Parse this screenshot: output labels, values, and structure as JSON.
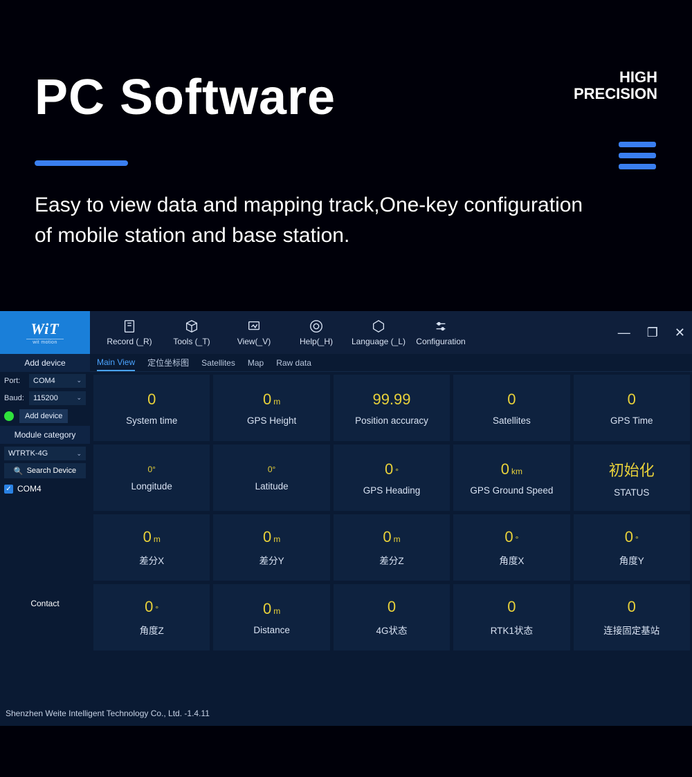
{
  "promo": {
    "title": "PC Software",
    "tag1": "HIGH",
    "tag2": "PRECISION",
    "desc": "Easy to view data and mapping track,One-key configuration of mobile station and base station."
  },
  "sidebar": {
    "logo_main": "WiT",
    "logo_sub": "wit motion",
    "add_device_head": "Add device",
    "port_label": "Port:",
    "port_value": "COM4",
    "baud_label": "Baud:",
    "baud_value": "115200",
    "add_btn": "Add device",
    "module_cat": "Module category",
    "module_value": "WTRTK-4G",
    "search_device": "Search Device",
    "device_item": "COM4",
    "contact": "Contact"
  },
  "toolbar": {
    "items": [
      {
        "label": "Record (_R)"
      },
      {
        "label": "Tools (_T)"
      },
      {
        "label": "View(_V)"
      },
      {
        "label": "Help(_H)"
      },
      {
        "label": "Language (_L)"
      },
      {
        "label": "Configuration"
      }
    ]
  },
  "tabs": [
    "Main View",
    "定位坐标图",
    "Satellites",
    "Map",
    "Raw data"
  ],
  "tiles": [
    {
      "value": "0",
      "unit": "",
      "label": "System time"
    },
    {
      "value": "0",
      "unit": "m",
      "label": "GPS Height"
    },
    {
      "value": "99.99",
      "unit": "",
      "label": "Position accuracy"
    },
    {
      "value": "0",
      "unit": "",
      "label": "Satellites"
    },
    {
      "value": "0",
      "unit": "",
      "label": "GPS Time"
    },
    {
      "value": "0°",
      "unit": "",
      "label": "Longitude",
      "small": true
    },
    {
      "value": "0°",
      "unit": "",
      "label": "Latitude",
      "small": true
    },
    {
      "value": "0",
      "unit": "°",
      "label": "GPS Heading"
    },
    {
      "value": "0",
      "unit": "km",
      "label": "GPS Ground Speed"
    },
    {
      "value": "初始化",
      "unit": "",
      "label": "STATUS"
    },
    {
      "value": "0",
      "unit": "m",
      "label": "差分X"
    },
    {
      "value": "0",
      "unit": "m",
      "label": "差分Y"
    },
    {
      "value": "0",
      "unit": "m",
      "label": "差分Z"
    },
    {
      "value": "0",
      "unit": "°",
      "label": "角度X"
    },
    {
      "value": "0",
      "unit": "°",
      "label": "角度Y"
    },
    {
      "value": "0",
      "unit": "°",
      "label": "角度Z"
    },
    {
      "value": "0",
      "unit": "m",
      "label": "Distance"
    },
    {
      "value": "0",
      "unit": "",
      "label": "4G状态"
    },
    {
      "value": "0",
      "unit": "",
      "label": "RTK1状态"
    },
    {
      "value": "0",
      "unit": "",
      "label": "连接固定基站"
    }
  ],
  "footer": "Shenzhen Weite Intelligent Technology Co., Ltd. -1.4.11"
}
